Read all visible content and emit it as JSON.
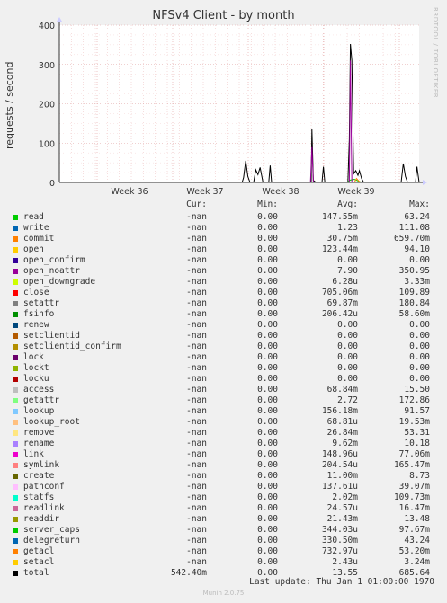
{
  "chart_data": {
    "type": "line",
    "title": "NFSv4 Client - by month",
    "ylabel": "requests / second",
    "ylim": [
      0,
      400
    ],
    "yticks": [
      "0",
      "100",
      "200",
      "300",
      "400"
    ],
    "xticks": [
      "Week 36",
      "Week 37",
      "Week 38",
      "Week 39"
    ],
    "grid": true,
    "series": [
      {
        "name": "total",
        "color": "#000000",
        "points": [
          [
            0,
            0
          ],
          [
            0.508,
            0
          ],
          [
            0.512,
            12
          ],
          [
            0.518,
            55
          ],
          [
            0.524,
            15
          ],
          [
            0.53,
            0
          ],
          [
            0.54,
            0
          ],
          [
            0.546,
            32
          ],
          [
            0.552,
            20
          ],
          [
            0.558,
            38
          ],
          [
            0.566,
            0
          ],
          [
            0.582,
            0
          ],
          [
            0.586,
            43
          ],
          [
            0.59,
            0
          ],
          [
            0.7,
            0
          ],
          [
            0.702,
            135
          ],
          [
            0.706,
            5
          ],
          [
            0.714,
            0
          ],
          [
            0.73,
            0
          ],
          [
            0.734,
            40
          ],
          [
            0.738,
            0
          ],
          [
            0.802,
            0
          ],
          [
            0.806,
            110
          ],
          [
            0.809,
            352
          ],
          [
            0.813,
            310
          ],
          [
            0.818,
            22
          ],
          [
            0.824,
            30
          ],
          [
            0.83,
            18
          ],
          [
            0.834,
            30
          ],
          [
            0.84,
            10
          ],
          [
            0.846,
            0
          ],
          [
            0.95,
            0
          ],
          [
            0.956,
            48
          ],
          [
            0.962,
            15
          ],
          [
            0.968,
            0
          ],
          [
            0.99,
            0
          ],
          [
            0.994,
            40
          ],
          [
            1.0,
            0
          ]
        ]
      },
      {
        "name": "read",
        "color": "#00cc00",
        "points": [
          [
            0,
            0
          ],
          [
            0.8,
            0
          ],
          [
            0.809,
            6
          ],
          [
            0.82,
            8
          ],
          [
            0.83,
            4
          ],
          [
            0.84,
            0
          ],
          [
            1.0,
            0
          ]
        ]
      },
      {
        "name": "open_noattr",
        "color": "#990099",
        "points": [
          [
            0,
            0
          ],
          [
            0.698,
            0
          ],
          [
            0.702,
            90
          ],
          [
            0.706,
            0
          ],
          [
            0.806,
            0
          ],
          [
            0.809,
            310
          ],
          [
            0.813,
            0
          ],
          [
            1.0,
            0
          ]
        ]
      },
      {
        "name": "commit",
        "color": "#ff8000",
        "points": [
          [
            0,
            0
          ],
          [
            0.82,
            0
          ],
          [
            0.826,
            10
          ],
          [
            0.834,
            2
          ],
          [
            0.84,
            0
          ],
          [
            1.0,
            0
          ]
        ]
      }
    ]
  },
  "legend": {
    "headers": {
      "cur": "Cur:",
      "min": "Min:",
      "avg": "Avg:",
      "max": "Max:"
    },
    "rows": [
      {
        "name": "read",
        "color": "#00cc00",
        "cur": "-nan",
        "min": "0.00",
        "avg": "147.55m",
        "max": "63.24"
      },
      {
        "name": "write",
        "color": "#0066b3",
        "cur": "-nan",
        "min": "0.00",
        "avg": "1.23",
        "max": "111.08"
      },
      {
        "name": "commit",
        "color": "#ff8000",
        "cur": "-nan",
        "min": "0.00",
        "avg": "30.75m",
        "max": "659.70m"
      },
      {
        "name": "open",
        "color": "#ffcc00",
        "cur": "-nan",
        "min": "0.00",
        "avg": "123.44m",
        "max": "94.10"
      },
      {
        "name": "open_confirm",
        "color": "#330099",
        "cur": "-nan",
        "min": "0.00",
        "avg": "0.00",
        "max": "0.00"
      },
      {
        "name": "open_noattr",
        "color": "#990099",
        "cur": "-nan",
        "min": "0.00",
        "avg": "7.90",
        "max": "350.95"
      },
      {
        "name": "open_downgrade",
        "color": "#ccff00",
        "cur": "-nan",
        "min": "0.00",
        "avg": "6.28u",
        "max": "3.33m"
      },
      {
        "name": "close",
        "color": "#ff0000",
        "cur": "-nan",
        "min": "0.00",
        "avg": "705.06m",
        "max": "109.89"
      },
      {
        "name": "setattr",
        "color": "#808080",
        "cur": "-nan",
        "min": "0.00",
        "avg": "69.87m",
        "max": "180.84"
      },
      {
        "name": "fsinfo",
        "color": "#008f00",
        "cur": "-nan",
        "min": "0.00",
        "avg": "206.42u",
        "max": "58.60m"
      },
      {
        "name": "renew",
        "color": "#00487d",
        "cur": "-nan",
        "min": "0.00",
        "avg": "0.00",
        "max": "0.00"
      },
      {
        "name": "setclientid",
        "color": "#b35a00",
        "cur": "-nan",
        "min": "0.00",
        "avg": "0.00",
        "max": "0.00"
      },
      {
        "name": "setclientid_confirm",
        "color": "#b38f00",
        "cur": "-nan",
        "min": "0.00",
        "avg": "0.00",
        "max": "0.00"
      },
      {
        "name": "lock",
        "color": "#6b006b",
        "cur": "-nan",
        "min": "0.00",
        "avg": "0.00",
        "max": "0.00"
      },
      {
        "name": "lockt",
        "color": "#8fb300",
        "cur": "-nan",
        "min": "0.00",
        "avg": "0.00",
        "max": "0.00"
      },
      {
        "name": "locku",
        "color": "#b30000",
        "cur": "-nan",
        "min": "0.00",
        "avg": "0.00",
        "max": "0.00"
      },
      {
        "name": "access",
        "color": "#bebebe",
        "cur": "-nan",
        "min": "0.00",
        "avg": "68.84m",
        "max": "15.50"
      },
      {
        "name": "getattr",
        "color": "#80ff80",
        "cur": "-nan",
        "min": "0.00",
        "avg": "2.72",
        "max": "172.86"
      },
      {
        "name": "lookup",
        "color": "#80c9ff",
        "cur": "-nan",
        "min": "0.00",
        "avg": "156.18m",
        "max": "91.57"
      },
      {
        "name": "lookup_root",
        "color": "#ffc080",
        "cur": "-nan",
        "min": "0.00",
        "avg": "68.81u",
        "max": "19.53m"
      },
      {
        "name": "remove",
        "color": "#ffe680",
        "cur": "-nan",
        "min": "0.00",
        "avg": "26.84m",
        "max": "53.31"
      },
      {
        "name": "rename",
        "color": "#aa80ff",
        "cur": "-nan",
        "min": "0.00",
        "avg": "9.62m",
        "max": "10.18"
      },
      {
        "name": "link",
        "color": "#ee00cc",
        "cur": "-nan",
        "min": "0.00",
        "avg": "148.96u",
        "max": "77.06m"
      },
      {
        "name": "symlink",
        "color": "#ff8080",
        "cur": "-nan",
        "min": "0.00",
        "avg": "204.54u",
        "max": "165.47m"
      },
      {
        "name": "create",
        "color": "#666600",
        "cur": "-nan",
        "min": "0.00",
        "avg": "11.00m",
        "max": "8.73"
      },
      {
        "name": "pathconf",
        "color": "#ffbfff",
        "cur": "-nan",
        "min": "0.00",
        "avg": "137.61u",
        "max": "39.07m"
      },
      {
        "name": "statfs",
        "color": "#00ffcc",
        "cur": "-nan",
        "min": "0.00",
        "avg": "2.02m",
        "max": "109.73m"
      },
      {
        "name": "readlink",
        "color": "#cc6699",
        "cur": "-nan",
        "min": "0.00",
        "avg": "24.57u",
        "max": "16.47m"
      },
      {
        "name": "readdir",
        "color": "#999900",
        "cur": "-nan",
        "min": "0.00",
        "avg": "21.43m",
        "max": "13.48"
      },
      {
        "name": "server_caps",
        "color": "#00cc00",
        "cur": "-nan",
        "min": "0.00",
        "avg": "344.03u",
        "max": "97.67m"
      },
      {
        "name": "delegreturn",
        "color": "#0066b3",
        "cur": "-nan",
        "min": "0.00",
        "avg": "330.50m",
        "max": "43.24"
      },
      {
        "name": "getacl",
        "color": "#ff8000",
        "cur": "-nan",
        "min": "0.00",
        "avg": "732.97u",
        "max": "53.20m"
      },
      {
        "name": "setacl",
        "color": "#ffcc00",
        "cur": "-nan",
        "min": "0.00",
        "avg": "2.43u",
        "max": "3.24m"
      },
      {
        "name": "total",
        "color": "#000000",
        "cur": "542.40m",
        "min": "0.00",
        "avg": "13.55",
        "max": "685.64"
      }
    ]
  },
  "footer": {
    "last_update": "Last update: Thu Jan  1 01:00:00 1970",
    "munin_version": "Munin 2.0.75"
  },
  "watermark": "RRDTOOL / TOBI OETIKER"
}
